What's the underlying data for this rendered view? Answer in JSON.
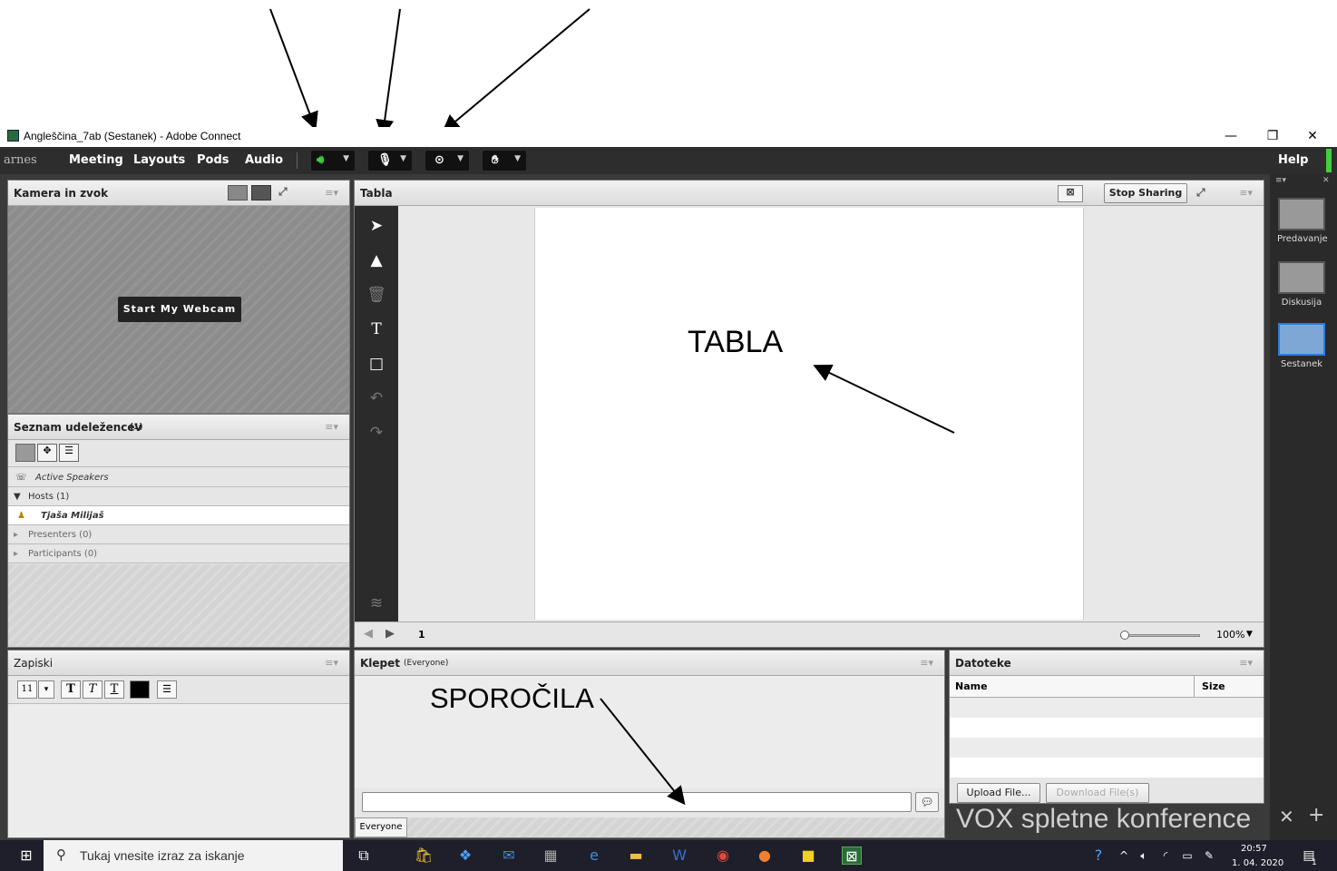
{
  "window": {
    "title": "Angleščina_7ab (Sestanek) - Adobe Connect",
    "minimize": "—",
    "restore": "❐",
    "close": "✕"
  },
  "menubar": {
    "logo": "arnes",
    "items": [
      "Meeting",
      "Layouts",
      "Pods",
      "Audio"
    ],
    "help": "Help"
  },
  "camera_pod": {
    "title": "Kamera in zvok",
    "start_webcam": "Start My Webcam"
  },
  "attendee_pod": {
    "title": "Seznam udeležencev",
    "count": "(1)",
    "active_speakers": "Active Speakers",
    "groups": [
      {
        "label": "Hosts (1)",
        "expanded": true
      },
      {
        "label": "Presenters (0)",
        "expanded": false
      },
      {
        "label": "Participants (0)",
        "expanded": false
      }
    ],
    "host_name": "Tjaša Milijaš"
  },
  "whiteboard_pod": {
    "title": "Tabla",
    "stop_sharing": "Stop Sharing",
    "page": "1",
    "zoom": "100%",
    "zoom_level": 0.05
  },
  "notes_pod": {
    "title": "Zapiski",
    "font_size": "11"
  },
  "chat_pod": {
    "title": "Klepet",
    "scope": "(Everyone)",
    "tab": "Everyone"
  },
  "files_pod": {
    "title": "Datoteke",
    "columns": [
      "Name",
      "Size"
    ],
    "upload": "Upload File...",
    "download": "Download File(s)"
  },
  "layouts_sidebar": {
    "items": [
      "Predavanje",
      "Diskusija",
      "Sestanek"
    ],
    "selected": "Sestanek"
  },
  "branding": "VOX spletne konference",
  "annotations": {
    "tabla": "TABLA",
    "sporocila": "SPOROČILA"
  },
  "taskbar": {
    "search_placeholder": "Tukaj vnesite izraz za iskanje",
    "time": "20:57",
    "date": "1. 04. 2020",
    "notification_count": "1"
  },
  "colors": {
    "menubar": "#2d2d2d",
    "speaker_active": "#3fcf3f",
    "sidebar_selected": "#2f7bd6"
  }
}
